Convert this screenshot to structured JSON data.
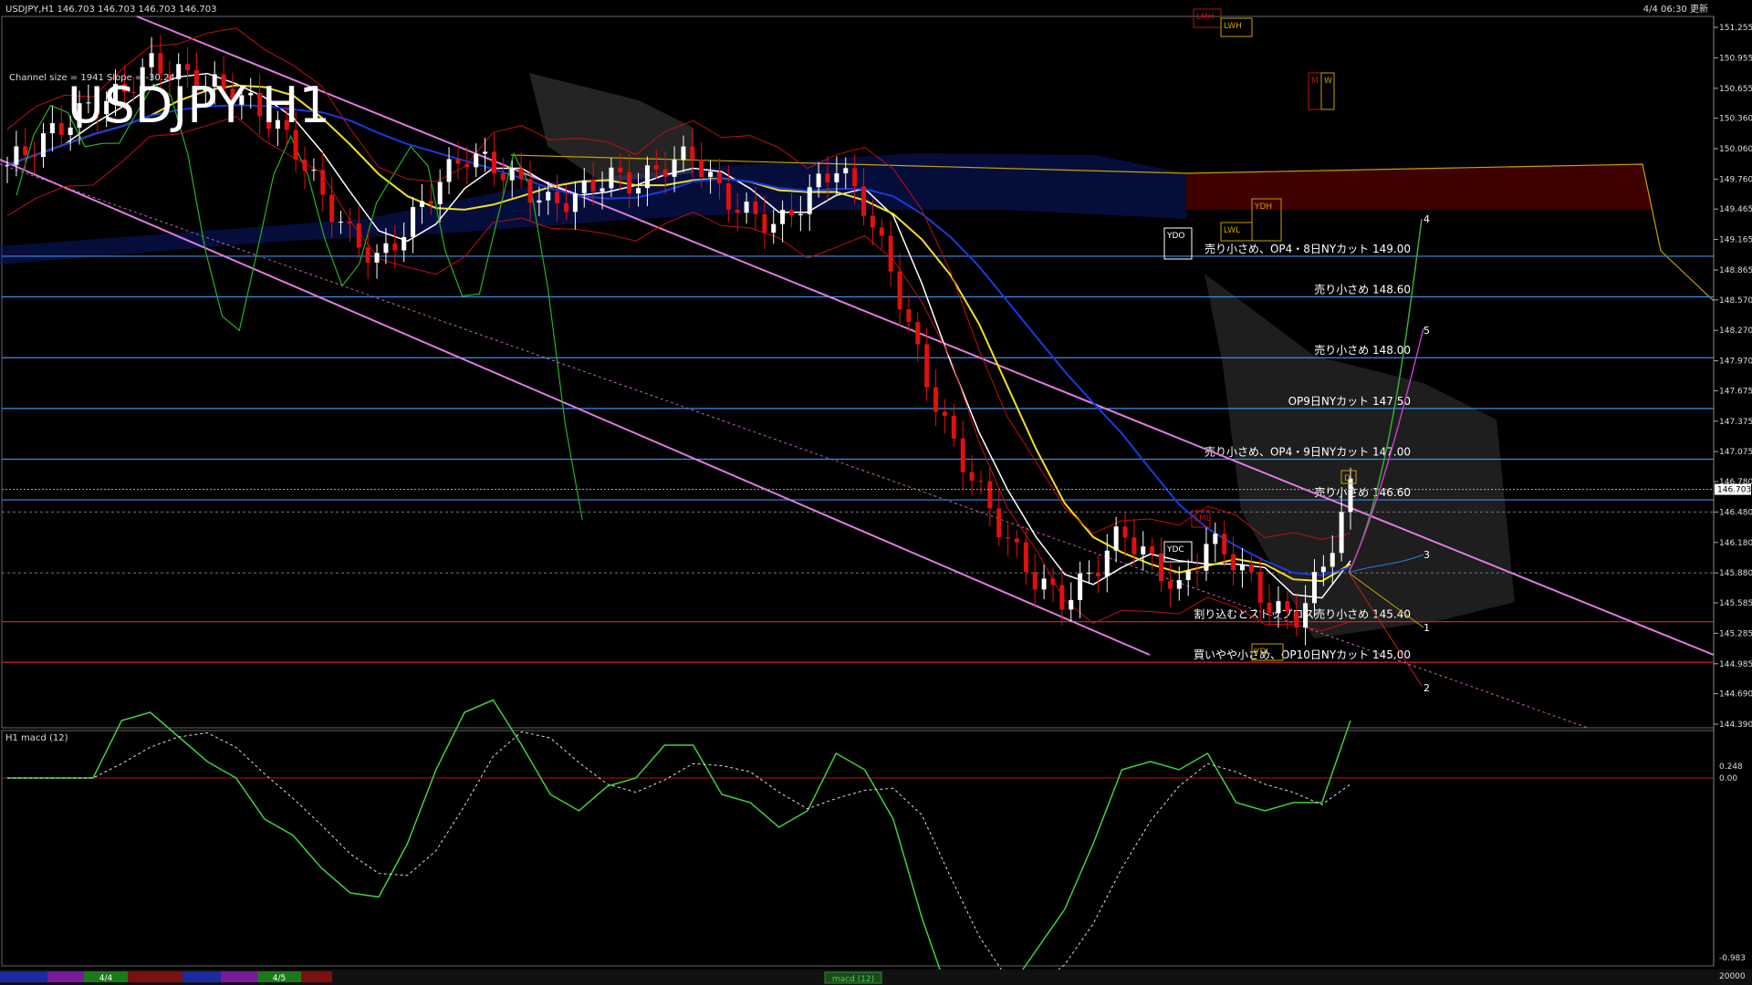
{
  "header": {
    "symbol_info": "USDJPY,H1",
    "ohlc": "146.703 146.703 146.703 146.703",
    "updated": "4/4 06:30 更新",
    "channel_info": "Channel size = 1941 Slope = -30.24",
    "big_title": "USDJPY H1"
  },
  "price_axis": {
    "min": 144.39,
    "max": 151.255,
    "ticks": [
      "151.255",
      "150.955",
      "150.655",
      "150.360",
      "150.060",
      "149.760",
      "149.465",
      "149.165",
      "148.865",
      "148.570",
      "148.270",
      "147.970",
      "147.675",
      "147.375",
      "147.075",
      "146.780",
      "146.480",
      "146.180",
      "145.880",
      "145.585",
      "145.285",
      "144.985",
      "144.690",
      "144.390"
    ],
    "current_price": "146.703"
  },
  "level_lines": [
    {
      "label": "売り小さめ、OP4・8日NYカット 149.00",
      "price": 149.0,
      "color": "#3a8ee6"
    },
    {
      "label": "売り小さめ 148.60",
      "price": 148.6,
      "color": "#3a8ee6"
    },
    {
      "label": "売り小さめ 148.00",
      "price": 148.0,
      "color": "#3a8ee6"
    },
    {
      "label": "OP9日NYカット 147.50",
      "price": 147.5,
      "color": "#3a8ee6"
    },
    {
      "label": "売り小さめ、OP4・9日NYカット 147.00",
      "price": 147.0,
      "color": "#3a8ee6"
    },
    {
      "label": "売り小さめ 146.60",
      "price": 146.6,
      "color": "#3a8ee6"
    },
    {
      "label": "割り込むとストップロス売り小さめ 145.40",
      "price": 145.4,
      "color": "#d42020"
    },
    {
      "label": "買いやや小さめ、OP10日NYカット 145.00",
      "price": 145.0,
      "color": "#d42020"
    }
  ],
  "box_labels": [
    "LMH",
    "LWH",
    "M",
    "W",
    "YDO",
    "LWL",
    "YDH",
    "YDC",
    "YDL",
    "LML",
    "D"
  ],
  "projection_labels": [
    "4",
    "5",
    "3",
    "1",
    "2"
  ],
  "macd_panel": {
    "title": "H1  macd (12)",
    "ticks": [
      "0.248",
      "0.00",
      "-0.983"
    ],
    "bottom_value": "20000"
  },
  "timeline": {
    "labels": [
      "4/4",
      "4/5"
    ],
    "tab": "macd (12)"
  },
  "chart_data": {
    "type": "line",
    "title": "USDJPY H1",
    "ylim": [
      144.39,
      151.255
    ],
    "series": [
      {
        "name": "",
        "values": [
          149.9,
          150.1,
          150.3,
          150.5,
          150.6,
          150.9,
          150.8,
          150.7,
          150.6,
          150.4,
          150.1,
          149.6,
          149.2,
          148.95,
          149.3,
          149.7,
          150.0,
          149.9,
          149.7,
          149.5,
          149.6,
          149.8,
          149.7,
          149.9,
          150.0,
          149.6,
          149.4,
          149.3,
          149.6,
          149.9,
          149.5,
          148.8,
          147.9,
          147.2,
          146.7,
          146.2,
          145.8,
          145.6,
          145.9,
          146.3,
          146.0,
          145.7,
          146.2,
          146.0,
          145.6,
          145.4,
          145.9,
          146.7
        ]
      }
    ]
  }
}
